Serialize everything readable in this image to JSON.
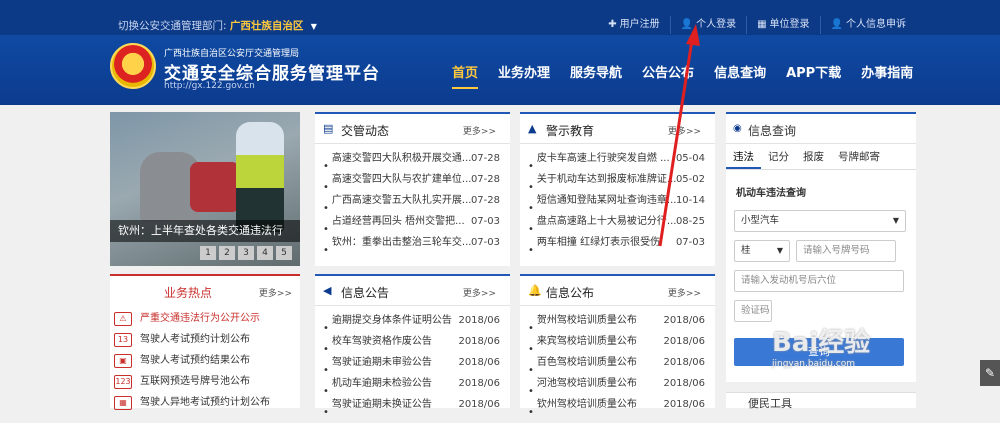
{
  "header": {
    "switch_label": "切换公安交通管理部门:",
    "region": "广西壮族自治区",
    "toplinks": [
      "用户注册",
      "个人登录",
      "单位登录",
      "个人信息申诉"
    ],
    "org": "广西壮族自治区公安厅交通管理局",
    "title": "交通安全综合服务管理平台",
    "url": "http://gx.122.gov.cn",
    "nav": [
      "首页",
      "业务办理",
      "服务导航",
      "公告公布",
      "信息查询",
      "APP下载",
      "办事指南"
    ]
  },
  "slide": {
    "caption": "钦州：上半年查处各类交通违法行",
    "pages": [
      "1",
      "2",
      "3",
      "4",
      "5"
    ]
  },
  "hot": {
    "title": "业务热点",
    "more": "更多>>",
    "items": [
      "严重交通违法行为公开公示",
      "驾驶人考试预约计划公布",
      "驾驶人考试预约结果公布",
      "互联网预选号牌号池公布",
      "驾驶人异地考试预约计划公布"
    ],
    "icons": [
      "warn-icon",
      "calendar-icon",
      "calendar-icon",
      "plate-icon",
      "calendar-icon"
    ]
  },
  "traffic_news": {
    "title": "交管动态",
    "more": "更多>>",
    "items": [
      {
        "t": "高速交警四大队积极开展交通...",
        "d": "07-28"
      },
      {
        "t": "高速交警四大队与农扩建单位...",
        "d": "07-28"
      },
      {
        "t": "广西高速交警五大队扎实开展...",
        "d": "07-28"
      },
      {
        "t": "占道经营再回头 梧州交警把...",
        "d": "07-03"
      },
      {
        "t": "钦州：重拳出击整治三轮车交...",
        "d": "07-03"
      }
    ]
  },
  "warning": {
    "title": "警示教育",
    "more": "更多>>",
    "items": [
      {
        "t": "皮卡车高速上行驶突发自燃 ...",
        "d": "05-04"
      },
      {
        "t": "关于机动车达到报废标准牌证...",
        "d": "05-02"
      },
      {
        "t": "短信通知登陆某网址查询违章...",
        "d": "10-14"
      },
      {
        "t": "盘点高速路上十大易被记分行...",
        "d": "08-25"
      },
      {
        "t": "两车相撞 红绿灯表示很受伤",
        "d": "07-03"
      }
    ]
  },
  "info_notice": {
    "title": "信息公告",
    "more": "更多>>",
    "items": [
      {
        "t": "逾期提交身体条件证明公告",
        "d": "2018/06"
      },
      {
        "t": "校车驾驶资格作废公告",
        "d": "2018/06"
      },
      {
        "t": "驾驶证逾期未审验公告",
        "d": "2018/06"
      },
      {
        "t": "机动车逾期未检验公告",
        "d": "2018/06"
      },
      {
        "t": "驾驶证逾期未换证公告",
        "d": "2018/06"
      }
    ]
  },
  "info_publish": {
    "title": "信息公布",
    "more": "更多>>",
    "items": [
      {
        "t": "贺州驾校培训质量公布",
        "d": "2018/06"
      },
      {
        "t": "来宾驾校培训质量公布",
        "d": "2018/06"
      },
      {
        "t": "百色驾校培训质量公布",
        "d": "2018/06"
      },
      {
        "t": "河池驾校培训质量公布",
        "d": "2018/06"
      },
      {
        "t": "钦州驾校培训质量公布",
        "d": "2018/06"
      }
    ]
  },
  "query": {
    "title": "信息查询",
    "tabs": [
      "违法",
      "记分",
      "报废",
      "号牌邮寄"
    ],
    "label": "机动车违法查询",
    "vehicle_type": "小型汽车",
    "province": "桂",
    "plate_placeholder": "请输入号牌号码",
    "engine_placeholder": "请输入发动机号后六位",
    "captcha_placeholder": "验证码",
    "submit": "查询"
  },
  "tools": {
    "title": "便民工具"
  },
  "watermark": {
    "brand": "Bai经验",
    "url": "jingyan.baidu.com"
  },
  "colors": {
    "primary": "#0c3b8e",
    "accent": "#ffc83d",
    "hot": "#c9302c",
    "annotation": "#e02020"
  }
}
